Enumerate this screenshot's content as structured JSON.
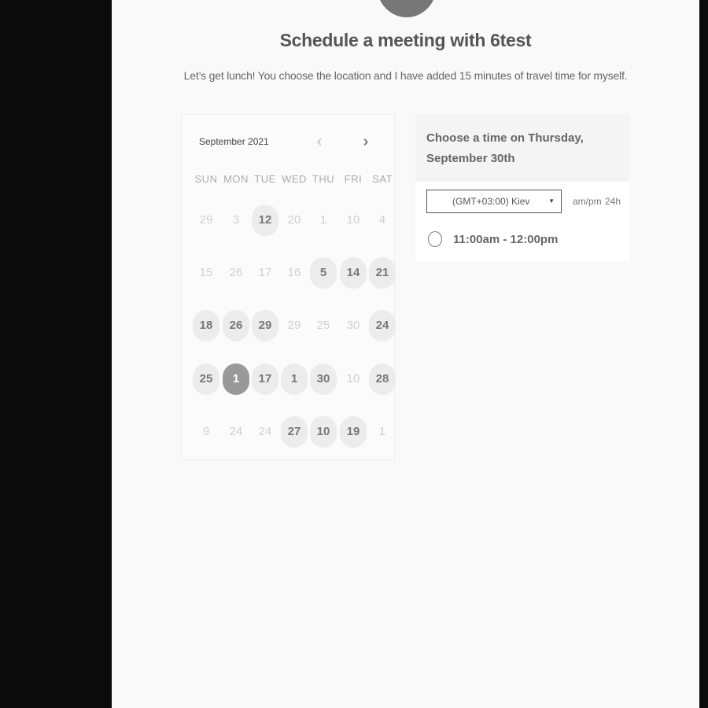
{
  "header": {
    "title": "Schedule a meeting with 6test",
    "subtitle": "Let’s get lunch! You choose the location and I have added 15 minutes of travel time for myself."
  },
  "calendar": {
    "month_label": "September 2021",
    "prev_icon": "chevron-left-icon",
    "next_icon": "chevron-right-icon",
    "weekdays": [
      "SUN",
      "MON",
      "TUE",
      "WED",
      "THU",
      "FRI",
      "SAT"
    ],
    "weeks": [
      [
        {
          "label": "29",
          "state": "disabled"
        },
        {
          "label": "3",
          "state": "disabled"
        },
        {
          "label": "12",
          "state": "available"
        },
        {
          "label": "20",
          "state": "disabled"
        },
        {
          "label": "1",
          "state": "disabled"
        },
        {
          "label": "10",
          "state": "disabled"
        },
        {
          "label": "4",
          "state": "disabled"
        }
      ],
      [
        {
          "label": "15",
          "state": "disabled"
        },
        {
          "label": "26",
          "state": "disabled"
        },
        {
          "label": "17",
          "state": "disabled"
        },
        {
          "label": "16",
          "state": "disabled"
        },
        {
          "label": "5",
          "state": "available"
        },
        {
          "label": "14",
          "state": "available"
        },
        {
          "label": "21",
          "state": "available"
        }
      ],
      [
        {
          "label": "18",
          "state": "available"
        },
        {
          "label": "26",
          "state": "available"
        },
        {
          "label": "29",
          "state": "available"
        },
        {
          "label": "29",
          "state": "disabled"
        },
        {
          "label": "25",
          "state": "disabled"
        },
        {
          "label": "30",
          "state": "disabled"
        },
        {
          "label": "24",
          "state": "available"
        }
      ],
      [
        {
          "label": "25",
          "state": "available"
        },
        {
          "label": "1",
          "state": "selected"
        },
        {
          "label": "17",
          "state": "available"
        },
        {
          "label": "1",
          "state": "available"
        },
        {
          "label": "30",
          "state": "available"
        },
        {
          "label": "10",
          "state": "disabled"
        },
        {
          "label": "28",
          "state": "available"
        }
      ],
      [
        {
          "label": "9",
          "state": "disabled"
        },
        {
          "label": "24",
          "state": "disabled"
        },
        {
          "label": "24",
          "state": "disabled"
        },
        {
          "label": "27",
          "state": "available"
        },
        {
          "label": "10",
          "state": "available"
        },
        {
          "label": "19",
          "state": "available"
        },
        {
          "label": "1",
          "state": "disabled"
        }
      ]
    ]
  },
  "times": {
    "title": "Choose a time on Thursday, September 30th",
    "timezone": "(GMT+03:00) Kiev",
    "timezone_icon": "caret-down-icon",
    "format_ampm": "am/pm",
    "format_24h": "24h",
    "slots": [
      {
        "label": "11:00am - 12:00pm",
        "icon": "radio-icon"
      }
    ]
  },
  "colors": {
    "background": "#0b0b0b",
    "page": "#f9f9f9",
    "selected_day": "#999999",
    "available_day": "#ececec"
  }
}
